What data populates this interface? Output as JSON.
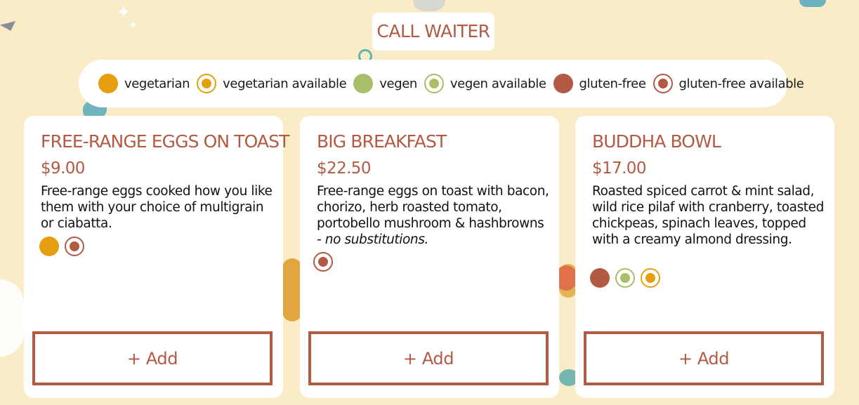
{
  "call_waiter": {
    "label": "CALL WAITER"
  },
  "legend": {
    "items": [
      {
        "label": "vegetarian",
        "icon": "vegetarian-dot-icon"
      },
      {
        "label": "vegetarian available",
        "icon": "vegetarian-available-ring-icon"
      },
      {
        "label": "vegen",
        "icon": "vegan-dot-icon"
      },
      {
        "label": "vegen available",
        "icon": "vegan-available-ring-icon"
      },
      {
        "label": "gluten-free",
        "icon": "gluten-free-dot-icon"
      },
      {
        "label": "gluten-free available",
        "icon": "gluten-free-available-ring-icon"
      }
    ]
  },
  "colors": {
    "accent": "#b35a45",
    "vegetarian": "#e59f10",
    "vegan": "#a9be68",
    "gluten_free": "#b35a45",
    "background": "#f9ecc7"
  },
  "menu": {
    "items": [
      {
        "title": "FREE-RANGE EGGS ON TOAST",
        "price": "$9.00",
        "description": "Free-range eggs cooked how you like them with your choice of multigrain or ciabatta.",
        "note": "",
        "badges": [
          "vegetarian",
          "gluten-free available"
        ],
        "add_label": "+ Add"
      },
      {
        "title": "BIG BREAKFAST",
        "price": "$22.50",
        "description": "Free-range eggs on toast with bacon, chorizo, herb roasted tomato, portobello mushroom & hashbrowns",
        "note": "- no substitutions.",
        "badges": [
          "gluten-free available"
        ],
        "add_label": "+ Add"
      },
      {
        "title": "BUDDHA BOWL",
        "price": "$17.00",
        "description": "Roasted spiced carrot & mint salad, wild rice pilaf with cranberry, toasted chickpeas, spinach leaves, topped with a creamy almond dressing.",
        "note": "",
        "badges": [
          "gluten-free",
          "vegen available",
          "vegetarian available"
        ],
        "add_label": "+ Add"
      }
    ]
  }
}
